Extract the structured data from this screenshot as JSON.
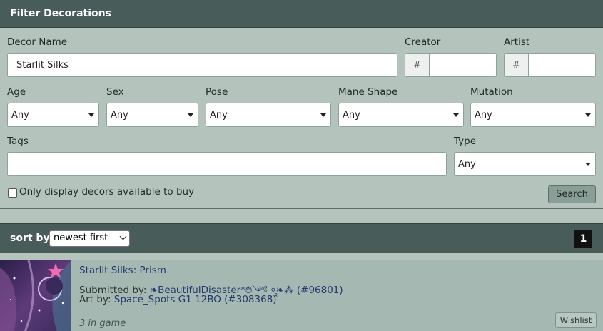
{
  "filter": {
    "title": "Filter Decorations",
    "decor_name": {
      "label": "Decor Name",
      "value": "Starlit Silks"
    },
    "creator": {
      "label": "Creator",
      "prefix": "#",
      "value": ""
    },
    "artist": {
      "label": "Artist",
      "prefix": "#",
      "value": ""
    },
    "age": {
      "label": "Age",
      "value": "Any"
    },
    "sex": {
      "label": "Sex",
      "value": "Any"
    },
    "pose": {
      "label": "Pose",
      "value": "Any"
    },
    "mane_shape": {
      "label": "Mane Shape",
      "value": "Any"
    },
    "mutation": {
      "label": "Mutation",
      "value": "Any"
    },
    "tags": {
      "label": "Tags",
      "value": ""
    },
    "type": {
      "label": "Type",
      "value": "Any"
    },
    "available_checkbox": {
      "label": "Only display decors available to buy",
      "checked": false
    },
    "search_label": "Search"
  },
  "sort": {
    "label": "sort by",
    "value": "newest first",
    "page": "1"
  },
  "result": {
    "title": "Starlit Silks: Prism",
    "submitted_prefix": "Submitted by:",
    "submitter": "❧BeautifulDisaster*࿉༺ ⸰̥̥❧⁂",
    "submitter_id": "(#96801)",
    "art_prefix": "Art by:",
    "artist": "Space_Spots G1 12BO (#308368)",
    "in_game": "3 in game",
    "wishlist_label": "Wishlist"
  },
  "colors": {
    "header": "#485d5a",
    "panel": "#b4c4bd",
    "link": "#223a6e"
  }
}
